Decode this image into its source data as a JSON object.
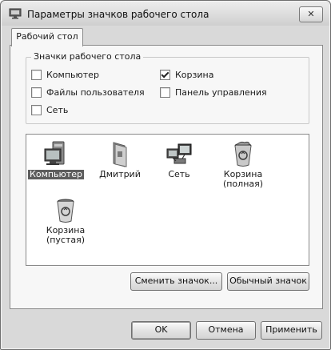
{
  "window": {
    "title": "Параметры значков рабочего стола",
    "app_icon": "desktop-properties-icon",
    "close_icon": "close-icon",
    "close_glyph": "✕"
  },
  "tabs": [
    {
      "label": "Рабочий стол",
      "selected": true
    }
  ],
  "desktop_icons_group": {
    "legend": "Значки рабочего стола",
    "checkboxes": [
      {
        "label": "Компьютер",
        "checked": false
      },
      {
        "label": "Корзина",
        "checked": true
      },
      {
        "label": "Файлы пользователя",
        "checked": false
      },
      {
        "label": "Панель управления",
        "checked": false
      },
      {
        "label": "Сеть",
        "checked": false
      }
    ]
  },
  "icon_list": {
    "items": [
      {
        "label": "Компьютер",
        "icon": "computer-icon",
        "selected": true
      },
      {
        "label": "Дмитрий",
        "icon": "user-folder-icon",
        "selected": false
      },
      {
        "label": "Сеть",
        "icon": "network-icon",
        "selected": false
      },
      {
        "label": "Корзина\n(полная)",
        "icon": "recycle-bin-full-icon",
        "selected": false
      },
      {
        "label": "Корзина\n(пустая)",
        "icon": "recycle-bin-empty-icon",
        "selected": false
      }
    ]
  },
  "icon_buttons": {
    "change_icon": "Сменить значок...",
    "restore_default": "Обычный значок"
  },
  "dialog_buttons": {
    "ok": "OK",
    "cancel": "Отмена",
    "apply": "Применить"
  }
}
